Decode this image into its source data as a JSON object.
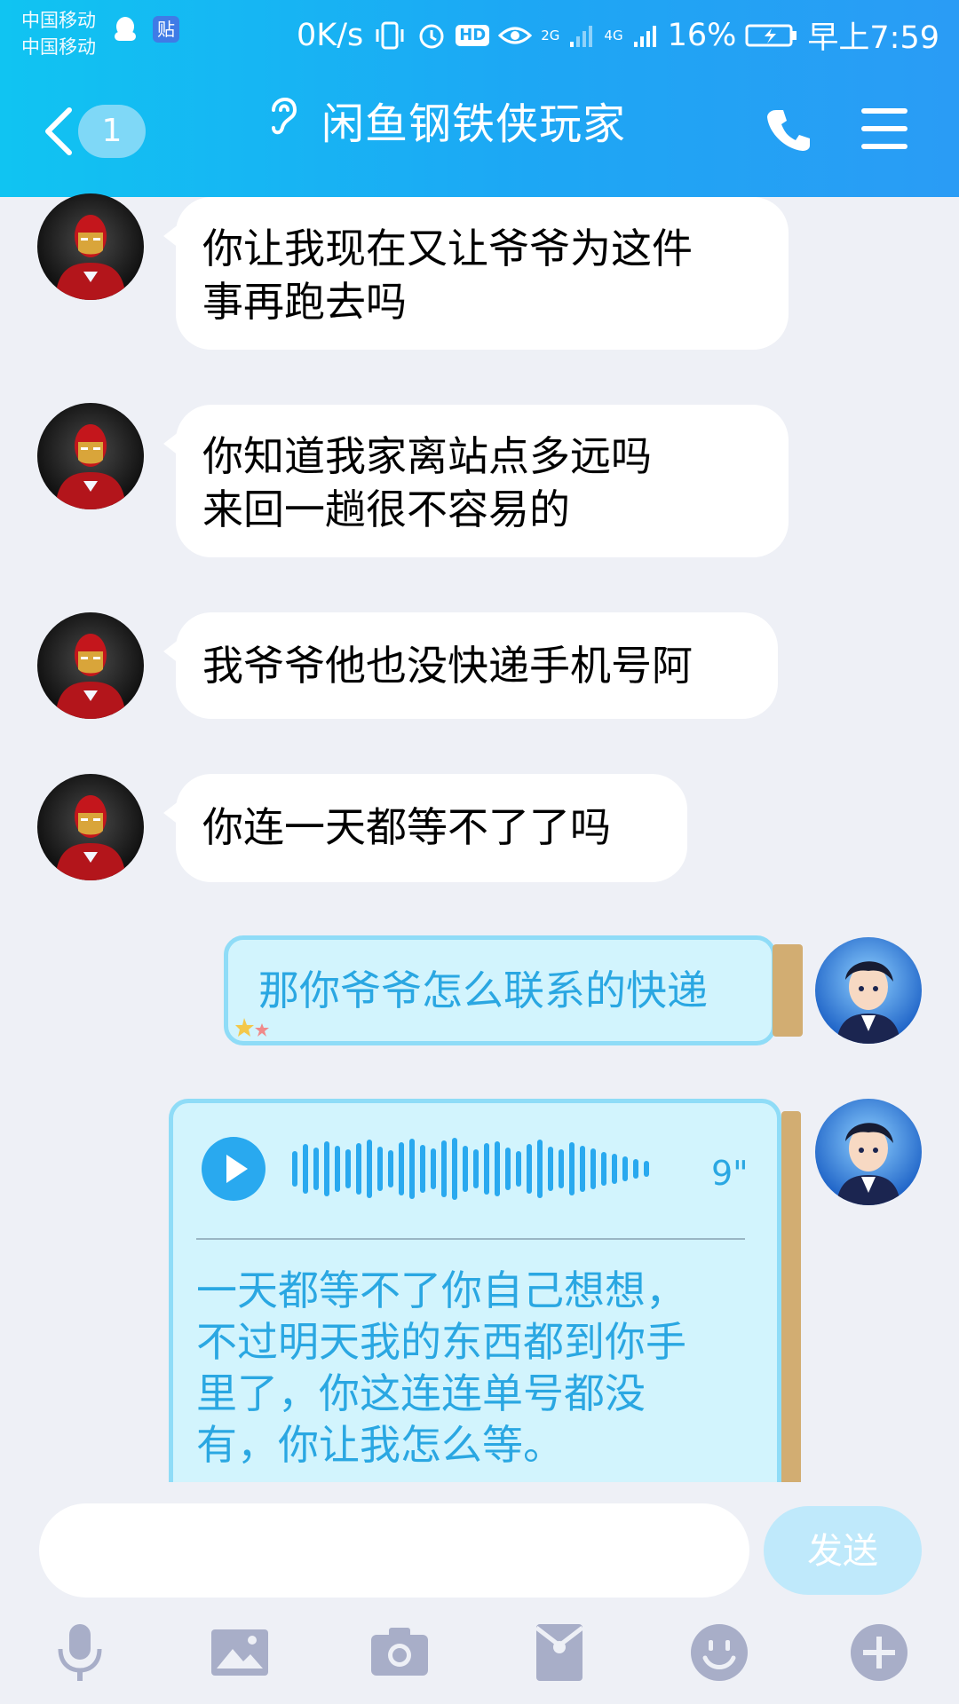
{
  "status_bar": {
    "carrier_1": "中国移动",
    "carrier_2": "中国移动",
    "tieba_label": "贴",
    "net_speed": "0K/s",
    "hd_label": "HD",
    "signal_1": "2G",
    "signal_2": "4G",
    "battery": "16%",
    "time": "早上7:59"
  },
  "header": {
    "unread_count": "1",
    "title": "闲鱼钢铁侠玩家",
    "accent": "#1da7f4"
  },
  "messages": [
    {
      "side": "left",
      "lines": [
        "你让我现在又让爷爷为这件",
        "事再跑去吗"
      ]
    },
    {
      "side": "left",
      "lines": [
        "你知道我家离站点多远吗",
        "来回一趟很不容易的"
      ]
    },
    {
      "side": "left",
      "lines": [
        "我爷爷他也没快递手机号阿"
      ]
    },
    {
      "side": "left",
      "lines": [
        "你连一天都等不了了吗"
      ]
    },
    {
      "side": "right",
      "lines": [
        "那你爷爷怎么联系的快递"
      ]
    },
    {
      "side": "right",
      "voice_duration": "9\"",
      "lines": [
        "一天都等不了你自己想想，",
        "不过明天我的东西都到你手",
        "里了，你这连连单号都没",
        "有，你让我怎么等。"
      ]
    }
  ],
  "input_bar": {
    "send_label": "发送"
  },
  "toolbar": [
    "mic-icon",
    "image-icon",
    "camera-icon",
    "red-packet-icon",
    "emoji-icon",
    "plus-icon"
  ]
}
